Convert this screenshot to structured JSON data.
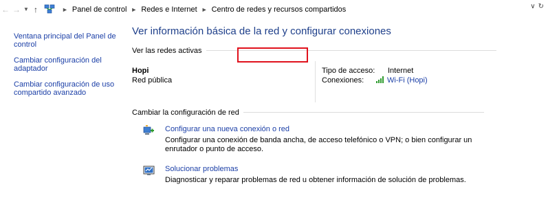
{
  "address_bar": {
    "breadcrumbs": [
      "Panel de control",
      "Redes e Internet",
      "Centro de redes y recursos compartidos"
    ]
  },
  "left_nav": {
    "items": [
      "Ventana principal del Panel de control",
      "Cambiar configuración del adaptador",
      "Cambiar configuración de uso compartido avanzado"
    ]
  },
  "main": {
    "title": "Ver información básica de la red y configurar conexiones",
    "active_networks": {
      "heading": "Ver las redes activas",
      "network_name": "Hopi",
      "network_type": "Red pública",
      "access_type_label": "Tipo de acceso:",
      "access_type_value": "Internet",
      "connections_label": "Conexiones:",
      "connection_link": "Wi-Fi (Hopi)"
    },
    "change_settings": {
      "heading": "Cambiar la configuración de red",
      "tasks": [
        {
          "link": "Configurar una nueva conexión o red",
          "description": "Configurar una conexión de banda ancha, de acceso telefónico o VPN; o bien configurar un enrutador o punto de acceso."
        },
        {
          "link": "Solucionar problemas",
          "description": "Diagnosticar y reparar problemas de red u obtener información de solución de problemas."
        }
      ]
    }
  },
  "colors": {
    "link": "#1a3ea6",
    "title": "#1e3f8a",
    "highlight": "#e0101b",
    "signal": "#2e9b2e"
  },
  "icons": [
    "back-arrow-icon",
    "forward-arrow-icon",
    "recent-dropdown-icon",
    "up-arrow-icon",
    "network-center-icon",
    "address-dropdown-icon",
    "refresh-icon",
    "wifi-signal-icon",
    "new-connection-icon",
    "troubleshoot-icon"
  ]
}
